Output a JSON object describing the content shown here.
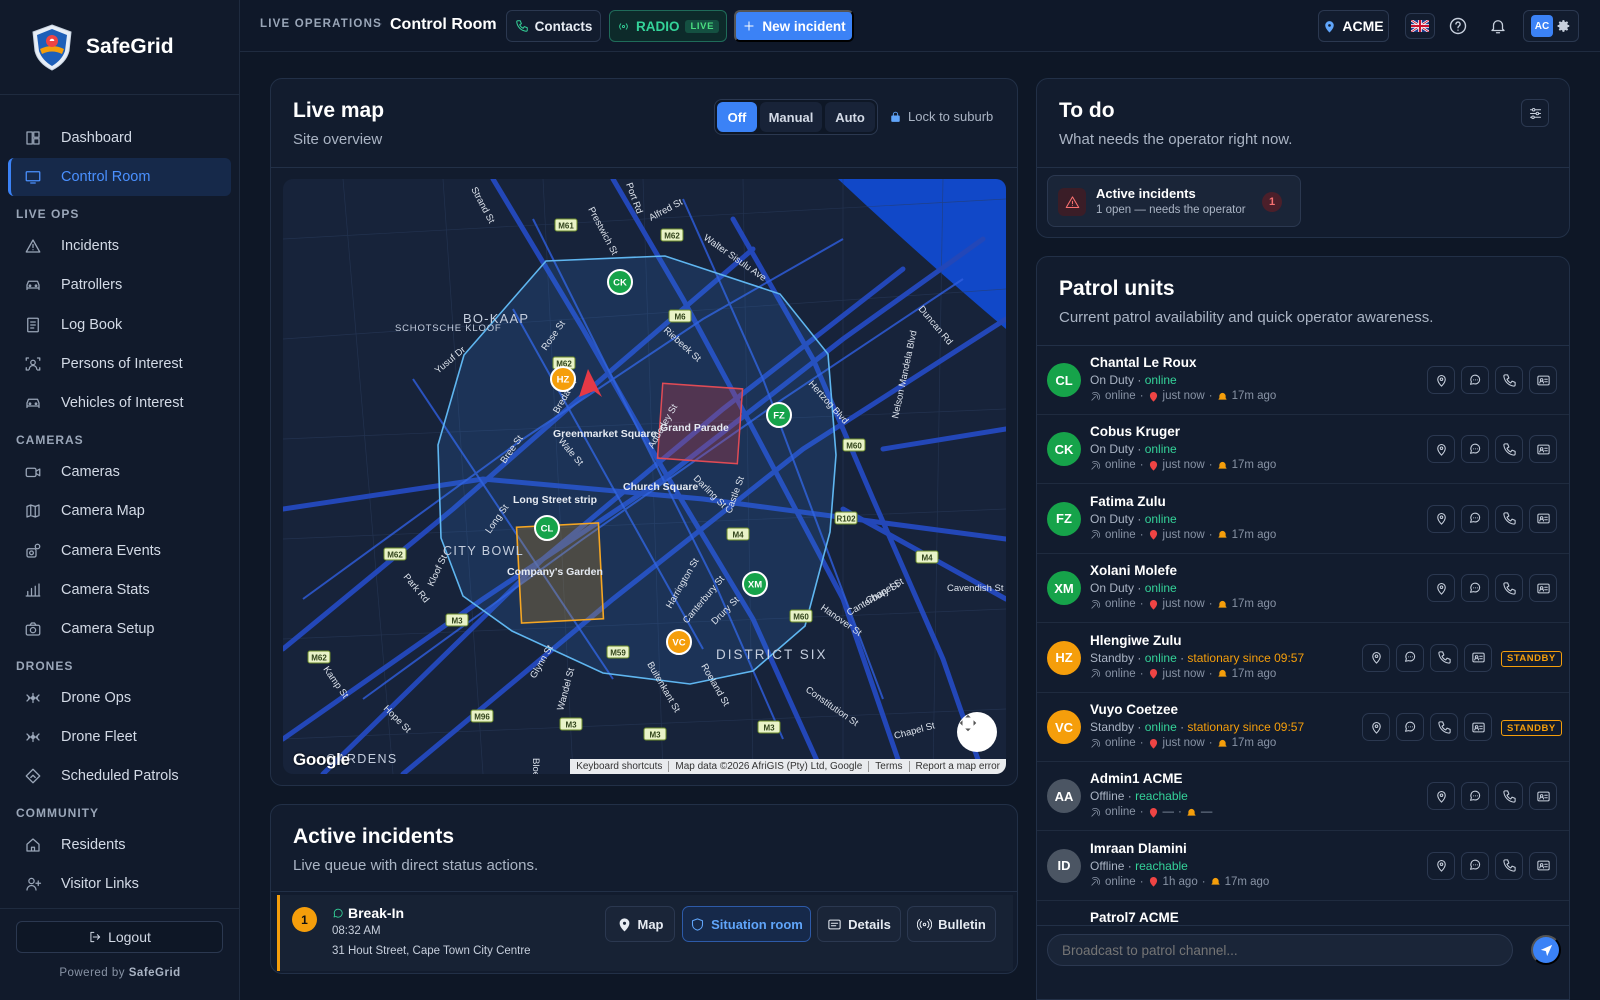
{
  "sidebar": {
    "brand": "SafeGrid",
    "items": [
      {
        "type": "item",
        "label": "Dashboard",
        "icon": "dashboard-icon"
      },
      {
        "type": "item",
        "label": "Control Room",
        "icon": "monitor-icon",
        "active": true
      },
      {
        "type": "section",
        "label": "LIVE OPS"
      },
      {
        "type": "item",
        "label": "Incidents",
        "icon": "alert-triangle-icon"
      },
      {
        "type": "item",
        "label": "Patrollers",
        "icon": "car-icon"
      },
      {
        "type": "item",
        "label": "Log Book",
        "icon": "logbook-icon"
      },
      {
        "type": "item",
        "label": "Persons of Interest",
        "icon": "person-scan-icon"
      },
      {
        "type": "item",
        "label": "Vehicles of Interest",
        "icon": "car-icon"
      },
      {
        "type": "section",
        "label": "CAMERAS"
      },
      {
        "type": "item",
        "label": "Cameras",
        "icon": "camera-icon"
      },
      {
        "type": "item",
        "label": "Camera Map",
        "icon": "map-icon"
      },
      {
        "type": "item",
        "label": "Camera Events",
        "icon": "camera-events-icon"
      },
      {
        "type": "item",
        "label": "Camera Stats",
        "icon": "bar-chart-icon"
      },
      {
        "type": "item",
        "label": "Camera Setup",
        "icon": "camera-setup-icon"
      },
      {
        "type": "section",
        "label": "DRONES"
      },
      {
        "type": "item",
        "label": "Drone Ops",
        "icon": "drone-icon"
      },
      {
        "type": "item",
        "label": "Drone Fleet",
        "icon": "drone-icon"
      },
      {
        "type": "item",
        "label": "Scheduled Patrols",
        "icon": "route-icon"
      },
      {
        "type": "section",
        "label": "COMMUNITY"
      },
      {
        "type": "item",
        "label": "Residents",
        "icon": "home-icon"
      },
      {
        "type": "item",
        "label": "Visitor Links",
        "icon": "user-plus-icon"
      }
    ],
    "logout": "Logout",
    "powered_by": "Powered by",
    "powered_brand": "SafeGrid"
  },
  "topbar": {
    "crumb": "LIVE OPERATIONS",
    "title": "Control Room",
    "contacts": "Contacts",
    "radio": "RADIO",
    "radio_live": "LIVE",
    "new_incident": "New incident",
    "org": "ACME",
    "avatar": "AC"
  },
  "live_map": {
    "title": "Live map",
    "subtitle": "Site overview",
    "modes": [
      "Off",
      "Manual",
      "Auto"
    ],
    "active_mode": "Off",
    "lock": "Lock to suburb",
    "markers": [
      {
        "initials": "CK",
        "color": "#16a34a"
      },
      {
        "initials": "HZ",
        "color": "#f59e0b"
      },
      {
        "initials": "FZ",
        "color": "#16a34a"
      },
      {
        "initials": "CL",
        "color": "#16a34a"
      },
      {
        "initials": "XM",
        "color": "#16a34a"
      },
      {
        "initials": "VC",
        "color": "#f59e0b"
      }
    ],
    "place_labels": [
      "Greenmarket Square",
      "Grand Parade",
      "Church Square",
      "Long Street strip",
      "Company's Garden"
    ],
    "area_labels": [
      "BO-KAAP",
      "SCHOTSCHE KLOOF",
      "CITY BOWL",
      "DISTRICT SIX",
      "GARDENS"
    ],
    "street_labels": [
      "Strand St",
      "Port Rd",
      "Alfred St",
      "Prestwich St",
      "Walter Sisulu Ave",
      "Duncan Rd",
      "Riebeek St",
      "Rose St",
      "Yusuf Dr",
      "Hertzog Blvd",
      "Nelson Mandela Blvd",
      "Wale St",
      "Bree St",
      "Long St",
      "Adderley St",
      "Darling St",
      "Castle St",
      "Harrington St",
      "Canterbury St",
      "Drury St",
      "Hanover St",
      "Chapel St",
      "Kloof St",
      "Park Rd",
      "Kamp St",
      "Hope St",
      "Wandel St",
      "Glynn St",
      "Buitenkant St",
      "Roeland St",
      "Constitution St",
      "Canterbury St",
      "Chapel St",
      "Cavendish St",
      "Bloem St",
      "Breda St",
      "Buitengracht St"
    ],
    "route_shields": [
      "M61",
      "M62",
      "M6",
      "M62",
      "M60",
      "R102",
      "M4",
      "M62",
      "M3",
      "M59",
      "M60",
      "M4",
      "M62",
      "M96",
      "M3",
      "M3",
      "M3"
    ],
    "attribution": [
      "Keyboard shortcuts",
      "Map data ©2026 AfriGIS (Pty) Ltd, Google",
      "Terms",
      "Report a map error"
    ],
    "google": "Google"
  },
  "todo": {
    "title": "To do",
    "subtitle": "What needs the operator right now.",
    "card_title": "Active incidents",
    "card_sub": "1 open — needs the operator",
    "card_count": "1"
  },
  "patrol": {
    "title": "Patrol units",
    "subtitle": "Current patrol availability and quick operator awareness.",
    "units": [
      {
        "initials": "CL",
        "name": "Chantal Le Roux",
        "state": "On Duty",
        "conn": "online",
        "stationary": "",
        "meta_conn": "online",
        "meta_loc": "just now",
        "meta_alert": "17m ago",
        "color": "#16a34a",
        "badge": ""
      },
      {
        "initials": "CK",
        "name": "Cobus Kruger",
        "state": "On Duty",
        "conn": "online",
        "stationary": "",
        "meta_conn": "online",
        "meta_loc": "just now",
        "meta_alert": "17m ago",
        "color": "#16a34a",
        "badge": ""
      },
      {
        "initials": "FZ",
        "name": "Fatima Zulu",
        "state": "On Duty",
        "conn": "online",
        "stationary": "",
        "meta_conn": "online",
        "meta_loc": "just now",
        "meta_alert": "17m ago",
        "color": "#16a34a",
        "badge": ""
      },
      {
        "initials": "XM",
        "name": "Xolani Molefe",
        "state": "On Duty",
        "conn": "online",
        "stationary": "",
        "meta_conn": "online",
        "meta_loc": "just now",
        "meta_alert": "17m ago",
        "color": "#16a34a",
        "badge": ""
      },
      {
        "initials": "HZ",
        "name": "Hlengiwe Zulu",
        "state": "Standby",
        "conn": "online",
        "stationary": "stationary since 09:57",
        "meta_conn": "online",
        "meta_loc": "just now",
        "meta_alert": "17m ago",
        "color": "#f59e0b",
        "badge": "STANDBY"
      },
      {
        "initials": "VC",
        "name": "Vuyo Coetzee",
        "state": "Standby",
        "conn": "online",
        "stationary": "stationary since 09:57",
        "meta_conn": "online",
        "meta_loc": "just now",
        "meta_alert": "17m ago",
        "color": "#f59e0b",
        "badge": "STANDBY"
      },
      {
        "initials": "AA",
        "name": "Admin1 ACME",
        "state": "Offline",
        "conn": "reachable",
        "stationary": "",
        "meta_conn": "online",
        "meta_loc": "—",
        "meta_alert": "—",
        "color": "#4b5563",
        "badge": ""
      },
      {
        "initials": "ID",
        "name": "Imraan Dlamini",
        "state": "Offline",
        "conn": "reachable",
        "stationary": "",
        "meta_conn": "online",
        "meta_loc": "1h ago",
        "meta_alert": "17m ago",
        "color": "#4b5563",
        "badge": ""
      },
      {
        "initials": "",
        "name": "Patrol7 ACME",
        "state": "",
        "conn": "",
        "stationary": "",
        "meta_conn": "",
        "meta_loc": "",
        "meta_alert": "",
        "color": "#4b5563",
        "badge": ""
      }
    ],
    "broadcast_placeholder": "Broadcast to patrol channel..."
  },
  "incidents": {
    "title": "Active incidents",
    "subtitle": "Live queue with direct status actions.",
    "rows": [
      {
        "num": "1",
        "type": "Break-In",
        "time": "08:32 AM",
        "address": "31 Hout Street, Cape Town City Centre"
      }
    ],
    "actions": [
      "Map",
      "Situation room",
      "Details",
      "Bulletin"
    ]
  },
  "colors": {
    "accent": "#3b82f6",
    "online": "#34d399",
    "standby": "#f59e0b",
    "danger": "#f87171"
  }
}
